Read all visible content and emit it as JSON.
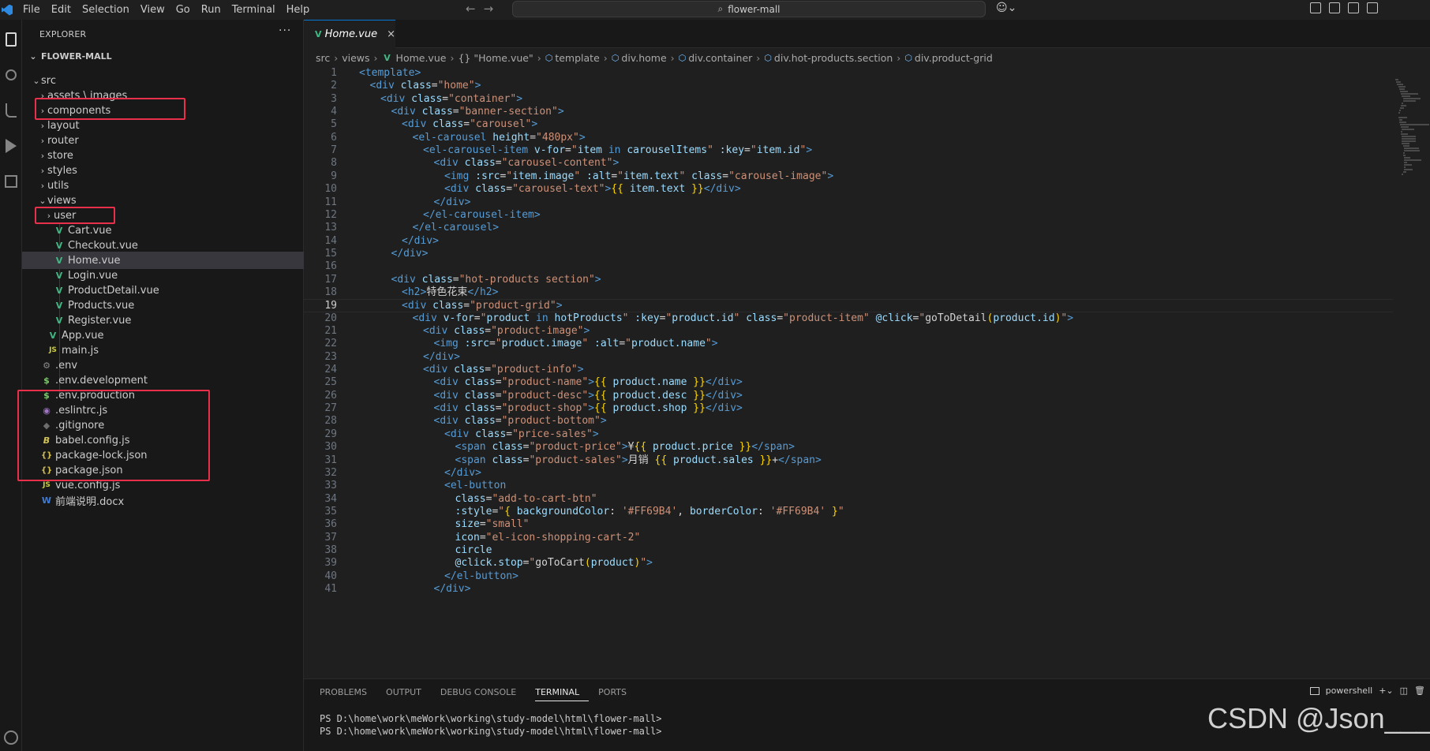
{
  "menu": [
    "File",
    "Edit",
    "Selection",
    "View",
    "Go",
    "Run",
    "Terminal",
    "Help"
  ],
  "command_center": "flower-mall",
  "sidebar": {
    "header": "EXPLORER",
    "more": "···",
    "root": "FLOWER-MALL"
  },
  "tree": [
    {
      "label": "src",
      "chev": "⌄",
      "icon": "",
      "depth": 1
    },
    {
      "label": "assets \\ images",
      "chev": "›",
      "icon": "",
      "depth": 2
    },
    {
      "label": "components",
      "chev": "›",
      "icon": "",
      "depth": 2
    },
    {
      "label": "layout",
      "chev": "›",
      "icon": "",
      "depth": 2
    },
    {
      "label": "router",
      "chev": "›",
      "icon": "",
      "depth": 2
    },
    {
      "label": "store",
      "chev": "›",
      "icon": "",
      "depth": 2
    },
    {
      "label": "styles",
      "chev": "›",
      "icon": "",
      "depth": 2
    },
    {
      "label": "utils",
      "chev": "›",
      "icon": "",
      "depth": 2
    },
    {
      "label": "views",
      "chev": "⌄",
      "icon": "",
      "depth": 2
    },
    {
      "label": "user",
      "chev": "›",
      "icon": "",
      "depth": 3
    },
    {
      "label": "Cart.vue",
      "chev": "",
      "icon": "V",
      "depth": 3
    },
    {
      "label": "Checkout.vue",
      "chev": "",
      "icon": "V",
      "depth": 3
    },
    {
      "label": "Home.vue",
      "chev": "",
      "icon": "V",
      "depth": 3,
      "selected": true
    },
    {
      "label": "Login.vue",
      "chev": "",
      "icon": "V",
      "depth": 3
    },
    {
      "label": "ProductDetail.vue",
      "chev": "",
      "icon": "V",
      "depth": 3
    },
    {
      "label": "Products.vue",
      "chev": "",
      "icon": "V",
      "depth": 3
    },
    {
      "label": "Register.vue",
      "chev": "",
      "icon": "V",
      "depth": 3
    },
    {
      "label": "App.vue",
      "chev": "",
      "icon": "V",
      "depth": 2
    },
    {
      "label": "main.js",
      "chev": "",
      "icon": "JS",
      "depth": 2
    },
    {
      "label": ".env",
      "chev": "",
      "icon": "⚙",
      "depth": 1
    },
    {
      "label": ".env.development",
      "chev": "",
      "icon": "$",
      "depth": 1
    },
    {
      "label": ".env.production",
      "chev": "",
      "icon": "$",
      "depth": 1
    },
    {
      "label": ".eslintrc.js",
      "chev": "",
      "icon": "◉",
      "depth": 1
    },
    {
      "label": ".gitignore",
      "chev": "",
      "icon": "◆",
      "depth": 1
    },
    {
      "label": "babel.config.js",
      "chev": "",
      "icon": "B",
      "depth": 1
    },
    {
      "label": "package-lock.json",
      "chev": "",
      "icon": "{}",
      "depth": 1
    },
    {
      "label": "package.json",
      "chev": "",
      "icon": "{}",
      "depth": 1
    },
    {
      "label": "vue.config.js",
      "chev": "",
      "icon": "JS",
      "depth": 1
    },
    {
      "label": "前端说明.docx",
      "chev": "",
      "icon": "W",
      "depth": 1
    }
  ],
  "editor": {
    "tab_label": "Home.vue",
    "tab_close": "×",
    "breadcrumb": [
      "src",
      "views",
      "Home.vue",
      "{} \"Home.vue\"",
      "template",
      "div.home",
      "div.container",
      "div.hot-products.section",
      "div.product-grid"
    ],
    "current_line": 19,
    "lines": [
      [
        [
          "t",
          "<template>"
        ]
      ],
      [
        [
          "t",
          "<div "
        ],
        [
          "a",
          "class"
        ],
        [
          "e",
          "="
        ],
        [
          "s",
          "\"home\""
        ],
        [
          "t",
          ">"
        ]
      ],
      [
        [
          "t",
          "<div "
        ],
        [
          "a",
          "class"
        ],
        [
          "e",
          "="
        ],
        [
          "s",
          "\"container\""
        ],
        [
          "t",
          ">"
        ]
      ],
      [
        [
          "t",
          "<div "
        ],
        [
          "a",
          "class"
        ],
        [
          "e",
          "="
        ],
        [
          "s",
          "\"banner-section\""
        ],
        [
          "t",
          ">"
        ]
      ],
      [
        [
          "t",
          "<div "
        ],
        [
          "a",
          "class"
        ],
        [
          "e",
          "="
        ],
        [
          "s",
          "\"carousel\""
        ],
        [
          "t",
          ">"
        ]
      ],
      [
        [
          "t",
          "<el-carousel "
        ],
        [
          "a",
          "height"
        ],
        [
          "e",
          "="
        ],
        [
          "s",
          "\"480px\""
        ],
        [
          "t",
          ">"
        ]
      ],
      [
        [
          "t",
          "<el-carousel-item "
        ],
        [
          "a",
          "v-for"
        ],
        [
          "e",
          "="
        ],
        [
          "s",
          "\""
        ],
        [
          "a",
          "item"
        ],
        [
          "t",
          " in "
        ],
        [
          "a",
          "carouselItems"
        ],
        [
          "s",
          "\""
        ],
        [
          "x",
          " "
        ],
        [
          "a",
          ":key"
        ],
        [
          "e",
          "="
        ],
        [
          "s",
          "\""
        ],
        [
          "a",
          "item.id"
        ],
        [
          "s",
          "\""
        ],
        [
          "t",
          ">"
        ]
      ],
      [
        [
          "t",
          "<div "
        ],
        [
          "a",
          "class"
        ],
        [
          "e",
          "="
        ],
        [
          "s",
          "\"carousel-content\""
        ],
        [
          "t",
          ">"
        ]
      ],
      [
        [
          "t",
          "<img "
        ],
        [
          "a",
          ":src"
        ],
        [
          "e",
          "="
        ],
        [
          "s",
          "\""
        ],
        [
          "a",
          "item.image"
        ],
        [
          "s",
          "\""
        ],
        [
          "x",
          " "
        ],
        [
          "a",
          ":alt"
        ],
        [
          "e",
          "="
        ],
        [
          "s",
          "\""
        ],
        [
          "a",
          "item.text"
        ],
        [
          "s",
          "\""
        ],
        [
          "x",
          " "
        ],
        [
          "a",
          "class"
        ],
        [
          "e",
          "="
        ],
        [
          "s",
          "\"carousel-image\""
        ],
        [
          "t",
          ">"
        ]
      ],
      [
        [
          "t",
          "<div "
        ],
        [
          "a",
          "class"
        ],
        [
          "e",
          "="
        ],
        [
          "s",
          "\"carousel-text\""
        ],
        [
          "t",
          ">"
        ],
        [
          "b",
          "{{"
        ],
        [
          "a",
          " item.text "
        ],
        [
          "b",
          "}}"
        ],
        [
          "t",
          "</div>"
        ]
      ],
      [
        [
          "t",
          "</div>"
        ]
      ],
      [
        [
          "t",
          "</el-carousel-item>"
        ]
      ],
      [
        [
          "t",
          "</el-carousel>"
        ]
      ],
      [
        [
          "t",
          "</div>"
        ]
      ],
      [
        [
          "t",
          "</div>"
        ]
      ],
      [],
      [
        [
          "t",
          "<div "
        ],
        [
          "a",
          "class"
        ],
        [
          "e",
          "="
        ],
        [
          "s",
          "\"hot-products section\""
        ],
        [
          "t",
          ">"
        ]
      ],
      [
        [
          "t",
          "<h2>"
        ],
        [
          "x",
          "特色花束"
        ],
        [
          "t",
          "</h2>"
        ]
      ],
      [
        [
          "t",
          "<div "
        ],
        [
          "a",
          "class"
        ],
        [
          "e",
          "="
        ],
        [
          "s",
          "\"product-grid\""
        ],
        [
          "t",
          ">"
        ]
      ],
      [
        [
          "t",
          "<div "
        ],
        [
          "a",
          "v-for"
        ],
        [
          "e",
          "="
        ],
        [
          "s",
          "\""
        ],
        [
          "a",
          "product"
        ],
        [
          "t",
          " in "
        ],
        [
          "a",
          "hotProducts"
        ],
        [
          "s",
          "\""
        ],
        [
          "x",
          " "
        ],
        [
          "a",
          ":key"
        ],
        [
          "e",
          "="
        ],
        [
          "s",
          "\""
        ],
        [
          "a",
          "product.id"
        ],
        [
          "s",
          "\""
        ],
        [
          "x",
          " "
        ],
        [
          "a",
          "class"
        ],
        [
          "e",
          "="
        ],
        [
          "s",
          "\"product-item\""
        ],
        [
          "x",
          " "
        ],
        [
          "a",
          "@click"
        ],
        [
          "e",
          "="
        ],
        [
          "s",
          "\""
        ],
        [
          "x",
          "goToDetail"
        ],
        [
          "b",
          "("
        ],
        [
          "a",
          "product.id"
        ],
        [
          "b",
          ")"
        ],
        [
          "s",
          "\""
        ],
        [
          "t",
          ">"
        ]
      ],
      [
        [
          "t",
          "<div "
        ],
        [
          "a",
          "class"
        ],
        [
          "e",
          "="
        ],
        [
          "s",
          "\"product-image\""
        ],
        [
          "t",
          ">"
        ]
      ],
      [
        [
          "t",
          "<img "
        ],
        [
          "a",
          ":src"
        ],
        [
          "e",
          "="
        ],
        [
          "s",
          "\""
        ],
        [
          "a",
          "product.image"
        ],
        [
          "s",
          "\""
        ],
        [
          "x",
          " "
        ],
        [
          "a",
          ":alt"
        ],
        [
          "e",
          "="
        ],
        [
          "s",
          "\""
        ],
        [
          "a",
          "product.name"
        ],
        [
          "s",
          "\""
        ],
        [
          "t",
          ">"
        ]
      ],
      [
        [
          "t",
          "</div>"
        ]
      ],
      [
        [
          "t",
          "<div "
        ],
        [
          "a",
          "class"
        ],
        [
          "e",
          "="
        ],
        [
          "s",
          "\"product-info\""
        ],
        [
          "t",
          ">"
        ]
      ],
      [
        [
          "t",
          "<div "
        ],
        [
          "a",
          "class"
        ],
        [
          "e",
          "="
        ],
        [
          "s",
          "\"product-name\""
        ],
        [
          "t",
          ">"
        ],
        [
          "b",
          "{{"
        ],
        [
          "a",
          " product.name "
        ],
        [
          "b",
          "}}"
        ],
        [
          "t",
          "</div>"
        ]
      ],
      [
        [
          "t",
          "<div "
        ],
        [
          "a",
          "class"
        ],
        [
          "e",
          "="
        ],
        [
          "s",
          "\"product-desc\""
        ],
        [
          "t",
          ">"
        ],
        [
          "b",
          "{{"
        ],
        [
          "a",
          " product.desc "
        ],
        [
          "b",
          "}}"
        ],
        [
          "t",
          "</div>"
        ]
      ],
      [
        [
          "t",
          "<div "
        ],
        [
          "a",
          "class"
        ],
        [
          "e",
          "="
        ],
        [
          "s",
          "\"product-shop\""
        ],
        [
          "t",
          ">"
        ],
        [
          "b",
          "{{"
        ],
        [
          "a",
          " product.shop "
        ],
        [
          "b",
          "}}"
        ],
        [
          "t",
          "</div>"
        ]
      ],
      [
        [
          "t",
          "<div "
        ],
        [
          "a",
          "class"
        ],
        [
          "e",
          "="
        ],
        [
          "s",
          "\"product-bottom\""
        ],
        [
          "t",
          ">"
        ]
      ],
      [
        [
          "t",
          "<div "
        ],
        [
          "a",
          "class"
        ],
        [
          "e",
          "="
        ],
        [
          "s",
          "\"price-sales\""
        ],
        [
          "t",
          ">"
        ]
      ],
      [
        [
          "t",
          "<span "
        ],
        [
          "a",
          "class"
        ],
        [
          "e",
          "="
        ],
        [
          "s",
          "\"product-price\""
        ],
        [
          "t",
          ">"
        ],
        [
          "x",
          "¥"
        ],
        [
          "b",
          "{{"
        ],
        [
          "a",
          " product.price "
        ],
        [
          "b",
          "}}"
        ],
        [
          "t",
          "</span>"
        ]
      ],
      [
        [
          "t",
          "<span "
        ],
        [
          "a",
          "class"
        ],
        [
          "e",
          "="
        ],
        [
          "s",
          "\"product-sales\""
        ],
        [
          "t",
          ">"
        ],
        [
          "x",
          "月销 "
        ],
        [
          "b",
          "{{"
        ],
        [
          "a",
          " product.sales "
        ],
        [
          "b",
          "}}"
        ],
        [
          "x",
          "+"
        ],
        [
          "t",
          "</span>"
        ]
      ],
      [
        [
          "t",
          "</div>"
        ]
      ],
      [
        [
          "t",
          "<el-button"
        ]
      ],
      [
        [
          "a",
          "class"
        ],
        [
          "e",
          "="
        ],
        [
          "s",
          "\"add-to-cart-btn\""
        ]
      ],
      [
        [
          "a",
          ":style"
        ],
        [
          "e",
          "="
        ],
        [
          "s",
          "\""
        ],
        [
          "b",
          "{"
        ],
        [
          "a",
          " backgroundColor"
        ],
        [
          "x",
          ": "
        ],
        [
          "s",
          "'#FF69B4'"
        ],
        [
          "x",
          ", "
        ],
        [
          "a",
          "borderColor"
        ],
        [
          "x",
          ": "
        ],
        [
          "s",
          "'#FF69B4'"
        ],
        [
          "x",
          " "
        ],
        [
          "b",
          "}"
        ],
        [
          "s",
          "\""
        ]
      ],
      [
        [
          "a",
          "size"
        ],
        [
          "e",
          "="
        ],
        [
          "s",
          "\"small\""
        ]
      ],
      [
        [
          "a",
          "icon"
        ],
        [
          "e",
          "="
        ],
        [
          "s",
          "\"el-icon-shopping-cart-2\""
        ]
      ],
      [
        [
          "a",
          "circle"
        ]
      ],
      [
        [
          "a",
          "@click.stop"
        ],
        [
          "e",
          "="
        ],
        [
          "s",
          "\""
        ],
        [
          "x",
          "goToCart"
        ],
        [
          "b",
          "("
        ],
        [
          "a",
          "product"
        ],
        [
          "b",
          ")"
        ],
        [
          "s",
          "\""
        ],
        [
          "t",
          ">"
        ]
      ],
      [
        [
          "t",
          "</el-button>"
        ]
      ],
      [
        [
          "t",
          "</div>"
        ]
      ]
    ],
    "indents": [
      0,
      1,
      2,
      3,
      4,
      5,
      6,
      7,
      8,
      8,
      7,
      6,
      5,
      4,
      3,
      0,
      3,
      4,
      4,
      5,
      6,
      7,
      6,
      6,
      7,
      7,
      7,
      7,
      8,
      9,
      9,
      8,
      8,
      9,
      9,
      9,
      9,
      9,
      9,
      8,
      7
    ]
  },
  "panel": {
    "tabs": [
      "PROBLEMS",
      "OUTPUT",
      "DEBUG CONSOLE",
      "TERMINAL",
      "PORTS"
    ],
    "active_tab": "TERMINAL",
    "shell": "powershell",
    "terminal_lines": [
      "PS D:\\home\\work\\meWork\\working\\study-model\\html\\flower-mall>",
      "PS D:\\home\\work\\meWork\\working\\study-model\\html\\flower-mall>"
    ]
  },
  "watermark": "CSDN @Json_____",
  "colors": {
    "accent": "#0078d4",
    "highlight_box": "#e8304a",
    "vue_icon": "#41b883"
  }
}
